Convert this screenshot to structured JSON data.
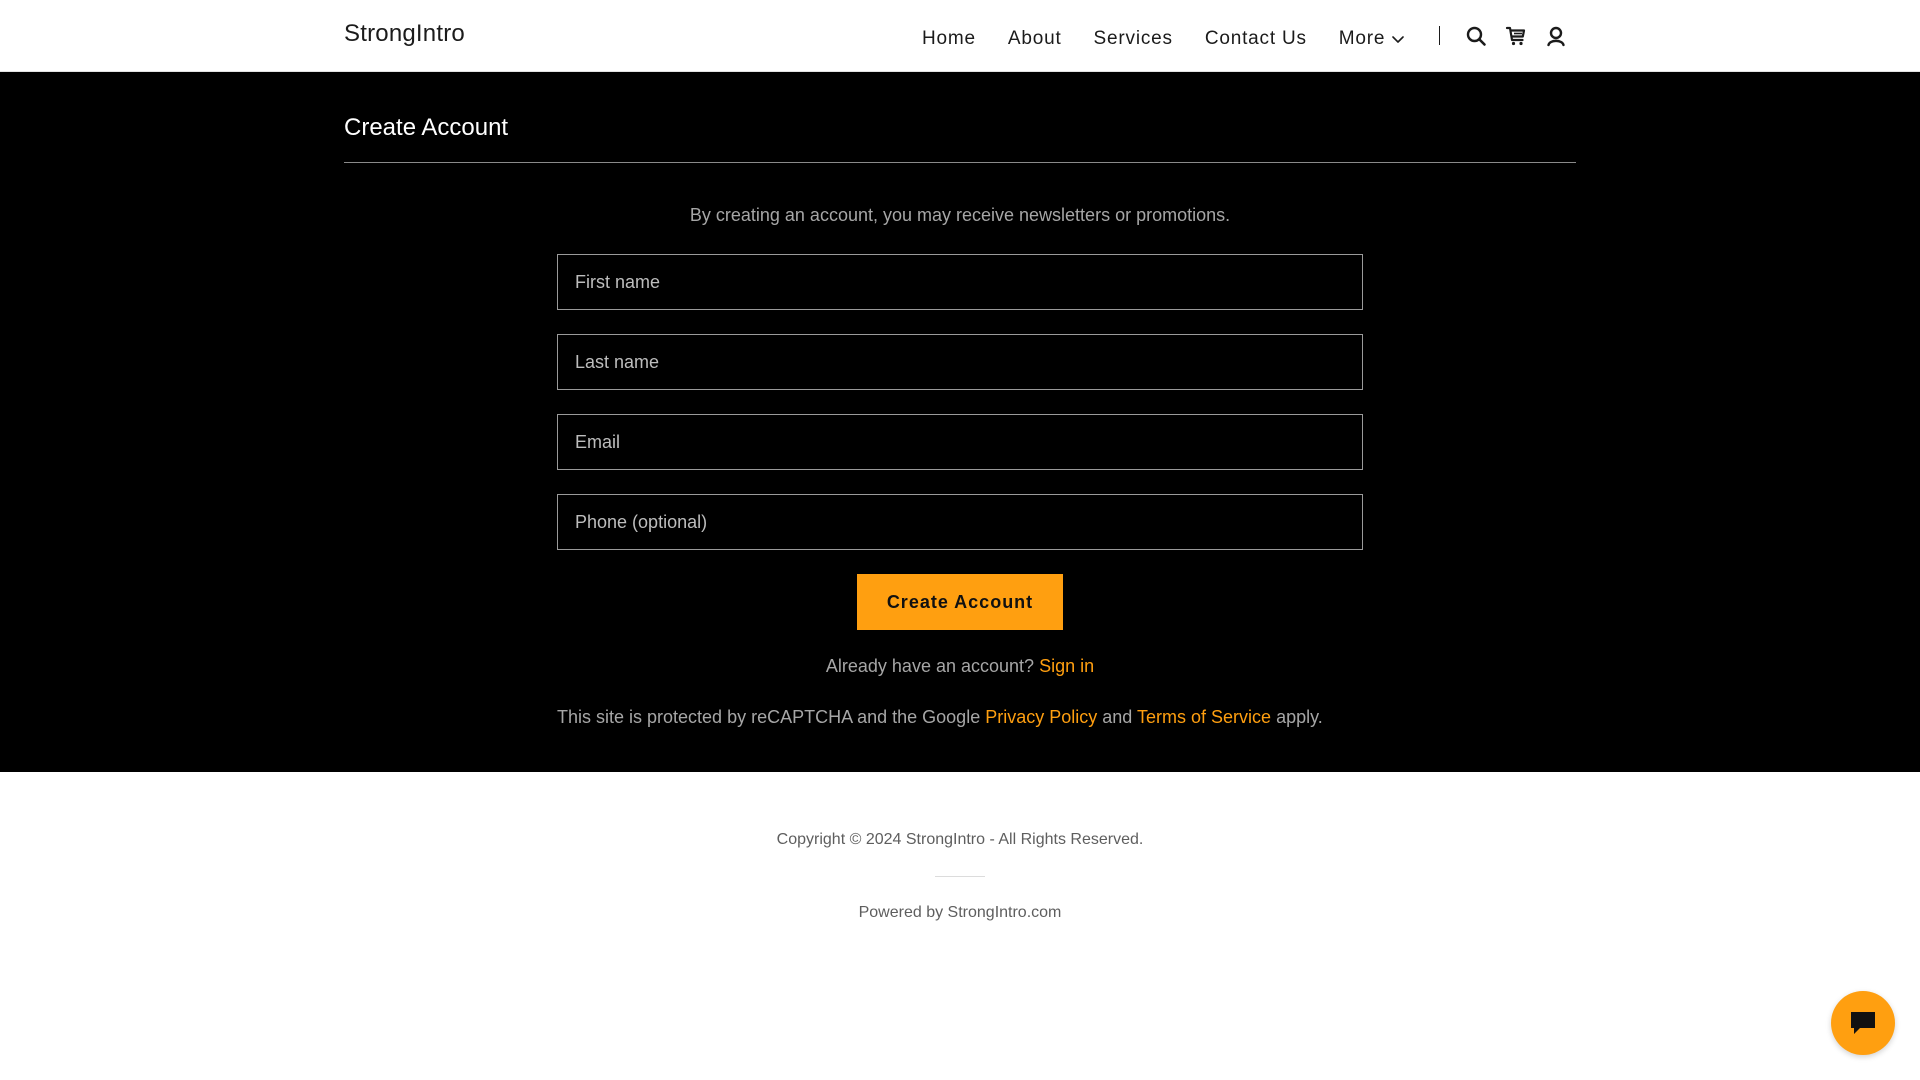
{
  "header": {
    "brand": "StrongIntro",
    "nav": [
      {
        "label": "Home"
      },
      {
        "label": "About"
      },
      {
        "label": "Services"
      },
      {
        "label": "Contact Us"
      }
    ],
    "more_label": "More",
    "icons": [
      "search-icon",
      "cart-icon",
      "account-icon"
    ]
  },
  "main": {
    "title": "Create Account",
    "subtitle": "By creating an account, you may receive newsletters or promotions.",
    "fields": {
      "first_name": {
        "placeholder": "First name",
        "value": ""
      },
      "last_name": {
        "placeholder": "Last name",
        "value": ""
      },
      "email": {
        "placeholder": "Email",
        "value": ""
      },
      "phone": {
        "placeholder": "Phone (optional)",
        "value": ""
      }
    },
    "submit_label": "Create Account",
    "signin_prompt": "Already have an account?",
    "signin_link": "Sign in",
    "recaptcha": {
      "prefix": "This site is protected by reCAPTCHA and the Google",
      "privacy_link": "Privacy Policy",
      "and": "and",
      "terms_link": "Terms of Service",
      "suffix": "apply."
    }
  },
  "footer": {
    "copyright": "Copyright © 2024 StrongIntro - All Rights Reserved.",
    "powered_by": "Powered by StrongIntro.com"
  },
  "chat": {
    "icon": "chat-icon"
  },
  "colors": {
    "accent": "#ff9f10",
    "main_bg": "#000000",
    "header_bg": "#ffffff",
    "muted_text": "#a6a6a6"
  }
}
